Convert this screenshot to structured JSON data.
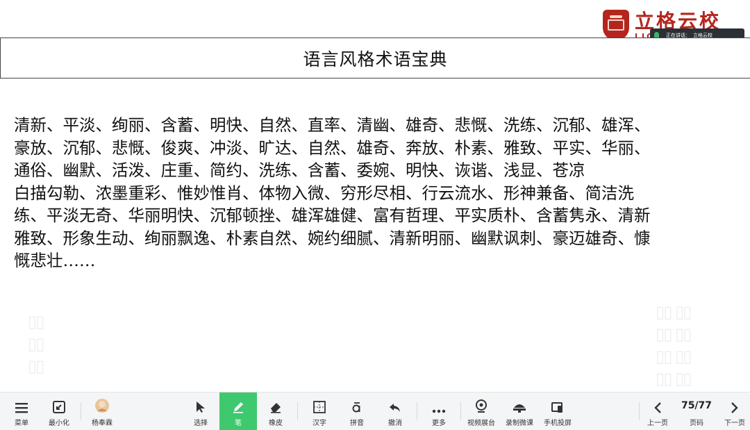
{
  "brand": {
    "logo_text": "立格云校",
    "logo_sub": "LIGE",
    "live_status": "正在讲话：",
    "live_speaker": "立格云校"
  },
  "slide": {
    "title": "语言风格术语宝典",
    "lines": [
      "清新、平淡、绚丽、含蓄、明快、自然、直率、清幽、雄奇、悲慨、洗练、沉郁、雄浑、",
      "豪放、沉郁、悲慨、俊爽、冲淡、旷达、自然、雄奇、奔放、朴素、雅致、平实、华丽、",
      "通俗、幽默、活泼、庄重、简约、洗练、含蓄、委婉、明快、诙谐、浅显、苍凉",
      "白描勾勒、浓墨重彩、惟妙惟肖、体物入微、穷形尽相、行云流水、形神兼备、简洁洗",
      "练、平淡无奇、华丽明快、沉郁顿挫、雄浑雄健、富有哲理、平实质朴、含蓄隽永、清新",
      "雅致、形象生动、绚丽飘逸、朴素自然、婉约细腻、清新明丽、幽默讽刺、豪迈雄奇、慷",
      "慨悲壮……"
    ]
  },
  "toolbar": {
    "menu": "菜单",
    "minimize": "最小化",
    "user": "杨奉霖",
    "select": "选择",
    "pen": "笔",
    "eraser": "橡皮",
    "hanzi": "汉字",
    "pinyin": "拼音",
    "undo": "撤消",
    "more": "更多",
    "video_booth": "视频展台",
    "record_lesson": "录制微课",
    "phone_cast": "手机投屏",
    "prev_page": "上一页",
    "page_label": "页码",
    "next_page": "下一页",
    "page_count": "75/77"
  },
  "colors": {
    "accent": "#3ec96f",
    "brand": "#b3261e",
    "pill_bg": "#2b2f36"
  }
}
